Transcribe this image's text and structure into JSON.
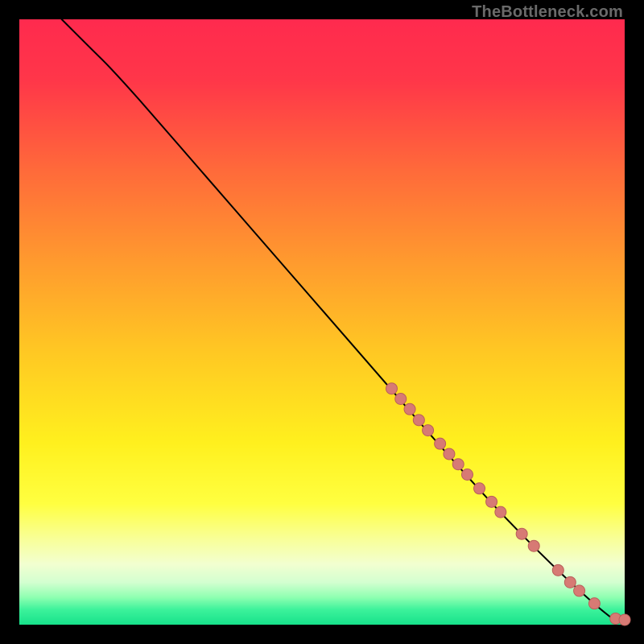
{
  "watermark": "TheBottleneck.com",
  "colors": {
    "background_outer": "#000000",
    "gradient_stops": [
      {
        "offset": 0.0,
        "color": "#ff2a4e"
      },
      {
        "offset": 0.1,
        "color": "#ff3649"
      },
      {
        "offset": 0.25,
        "color": "#ff6a3a"
      },
      {
        "offset": 0.4,
        "color": "#ff9a2e"
      },
      {
        "offset": 0.55,
        "color": "#ffc823"
      },
      {
        "offset": 0.7,
        "color": "#fff01e"
      },
      {
        "offset": 0.8,
        "color": "#ffff40"
      },
      {
        "offset": 0.86,
        "color": "#f8ff9a"
      },
      {
        "offset": 0.9,
        "color": "#f2ffd0"
      },
      {
        "offset": 0.93,
        "color": "#d3ffd0"
      },
      {
        "offset": 0.955,
        "color": "#8effb1"
      },
      {
        "offset": 0.975,
        "color": "#3df29b"
      },
      {
        "offset": 1.0,
        "color": "#17e28b"
      }
    ],
    "curve": "#000000",
    "marker_fill": "#d77a74",
    "marker_stroke": "#b95f5a"
  },
  "chart_data": {
    "type": "line",
    "title": "",
    "xlabel": "",
    "ylabel": "",
    "xlim": [
      0,
      100
    ],
    "ylim": [
      0,
      100
    ],
    "curve": [
      {
        "x": 7,
        "y": 100
      },
      {
        "x": 9,
        "y": 98
      },
      {
        "x": 12,
        "y": 95
      },
      {
        "x": 15,
        "y": 92
      },
      {
        "x": 20,
        "y": 86.5
      },
      {
        "x": 30,
        "y": 75
      },
      {
        "x": 40,
        "y": 63.5
      },
      {
        "x": 50,
        "y": 52
      },
      {
        "x": 60,
        "y": 40.5
      },
      {
        "x": 70,
        "y": 29
      },
      {
        "x": 80,
        "y": 18
      },
      {
        "x": 90,
        "y": 8
      },
      {
        "x": 98,
        "y": 1
      },
      {
        "x": 100,
        "y": 0.7
      }
    ],
    "series": [
      {
        "name": "highlighted-points",
        "points": [
          {
            "x": 61.5,
            "y": 39.0
          },
          {
            "x": 63.0,
            "y": 37.3
          },
          {
            "x": 64.5,
            "y": 35.6
          },
          {
            "x": 66.0,
            "y": 33.8
          },
          {
            "x": 67.5,
            "y": 32.1
          },
          {
            "x": 69.5,
            "y": 29.9
          },
          {
            "x": 71.0,
            "y": 28.2
          },
          {
            "x": 72.5,
            "y": 26.5
          },
          {
            "x": 74.0,
            "y": 24.8
          },
          {
            "x": 76.0,
            "y": 22.5
          },
          {
            "x": 78.0,
            "y": 20.3
          },
          {
            "x": 79.5,
            "y": 18.6
          },
          {
            "x": 83.0,
            "y": 15.0
          },
          {
            "x": 85.0,
            "y": 13.0
          },
          {
            "x": 89.0,
            "y": 9.0
          },
          {
            "x": 91.0,
            "y": 7.0
          },
          {
            "x": 92.5,
            "y": 5.6
          },
          {
            "x": 95.0,
            "y": 3.5
          },
          {
            "x": 98.5,
            "y": 1.0
          },
          {
            "x": 100.0,
            "y": 0.8
          }
        ]
      }
    ],
    "marker_radius_px": 7
  }
}
